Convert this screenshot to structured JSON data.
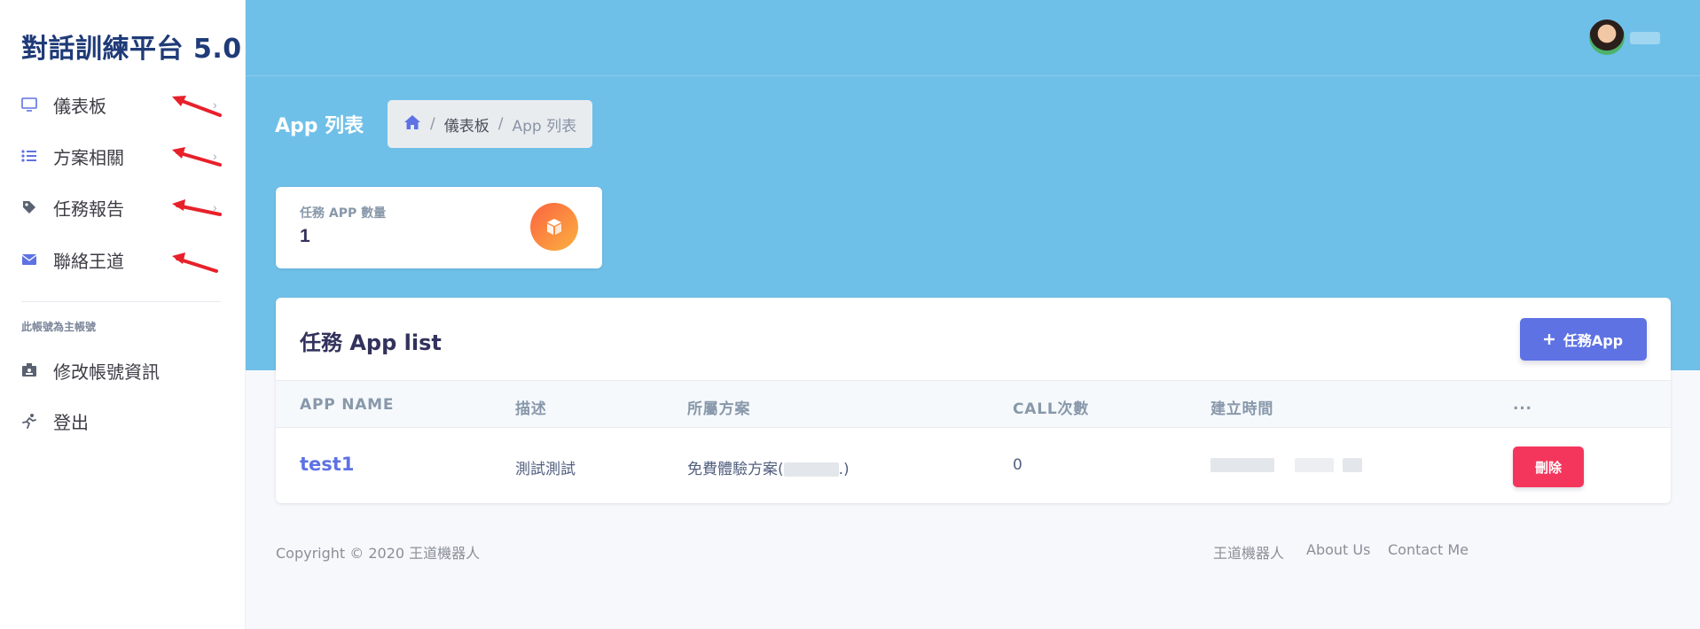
{
  "sidebar": {
    "brand": "對話訓練平台 5.0",
    "items": [
      {
        "label": "儀表板",
        "icon": "monitor-icon"
      },
      {
        "label": "方案相關",
        "icon": "list-icon"
      },
      {
        "label": "任務報告",
        "icon": "tag-icon"
      },
      {
        "label": "聯絡王道",
        "icon": "envelope-icon"
      }
    ],
    "section_note": "此帳號為主帳號",
    "account_items": [
      {
        "label": "修改帳號資訊",
        "icon": "id-badge-icon"
      },
      {
        "label": "登出",
        "icon": "running-icon"
      }
    ]
  },
  "header": {
    "page_title": "App 列表",
    "breadcrumb": [
      "儀表板",
      "App 列表"
    ]
  },
  "stat": {
    "title": "任務 APP 數量",
    "value": "1"
  },
  "table": {
    "title": "任務 App list",
    "add_label": "任務App",
    "columns": [
      "APP NAME",
      "描述",
      "所屬方案",
      "CALL次數",
      "建立時間",
      "..."
    ],
    "rows": [
      {
        "name": "test1",
        "desc": "測試測試",
        "plan_prefix": "免費體驗方案(",
        "plan_suffix": ".)",
        "calls": "0",
        "delete_label": "刪除"
      }
    ]
  },
  "footer": {
    "copyright": "Copyright © 2020 王道機器人",
    "links": [
      "王道機器人",
      "About Us",
      "Contact Me"
    ]
  },
  "colors": {
    "hero": "#6fc0e8",
    "primary": "#5e72e4",
    "danger": "#f5365c",
    "brand": "#1f3b78",
    "annotation_arrow": "#e8202a"
  }
}
